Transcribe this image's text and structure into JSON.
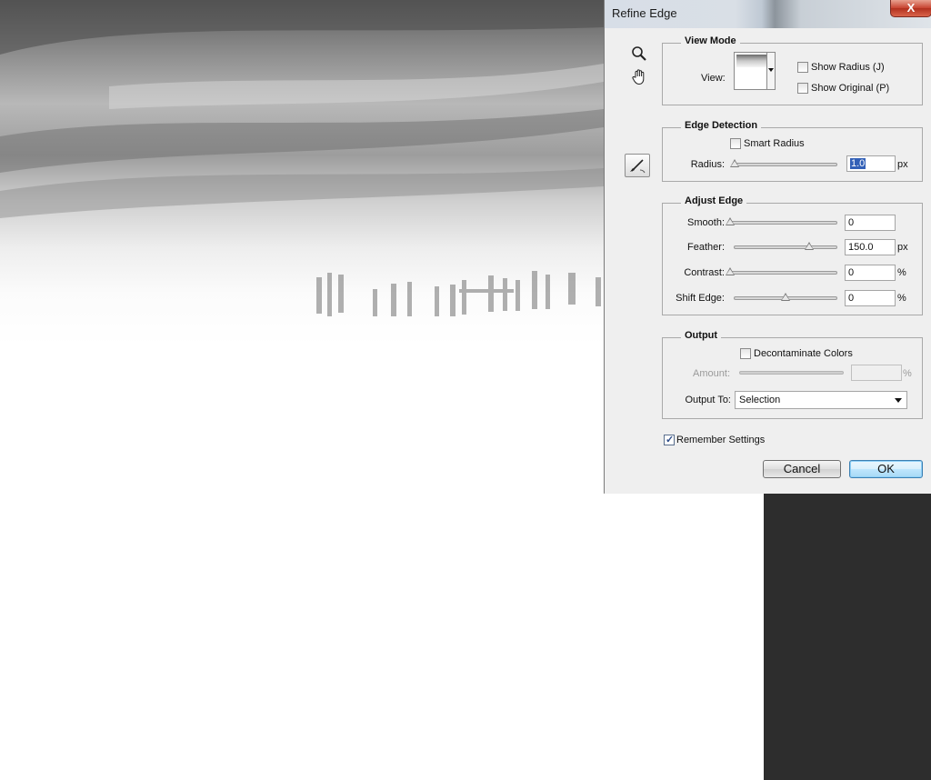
{
  "dialog": {
    "title": "Refine Edge",
    "close_label": "X"
  },
  "view_mode": {
    "legend": "View Mode",
    "view_label": "View:",
    "show_radius": {
      "label": "Show Radius (J)",
      "checked": false
    },
    "show_original": {
      "label": "Show Original (P)",
      "checked": false
    }
  },
  "edge_detection": {
    "legend": "Edge Detection",
    "smart_radius": {
      "label": "Smart Radius",
      "checked": false
    },
    "radius": {
      "label": "Radius:",
      "value": "1.0",
      "unit": "px",
      "slider_fraction": 0.0
    }
  },
  "adjust_edge": {
    "legend": "Adjust Edge",
    "smooth": {
      "label": "Smooth:",
      "value": "0",
      "unit": "",
      "slider_fraction": 0.0
    },
    "feather": {
      "label": "Feather:",
      "value": "150.0",
      "unit": "px",
      "slider_fraction": 0.73
    },
    "contrast": {
      "label": "Contrast:",
      "value": "0",
      "unit": "%",
      "slider_fraction": 0.0
    },
    "shift_edge": {
      "label": "Shift Edge:",
      "value": "0",
      "unit": "%",
      "slider_fraction": 0.5
    }
  },
  "output": {
    "legend": "Output",
    "decontaminate": {
      "label": "Decontaminate Colors",
      "checked": false
    },
    "amount": {
      "label": "Amount:",
      "value": "",
      "unit": "%"
    },
    "output_to_label": "Output To:",
    "output_to_value": "Selection"
  },
  "remember_settings": {
    "label": "Remember Settings",
    "checked": true
  },
  "buttons": {
    "cancel": "Cancel",
    "ok": "OK"
  },
  "tools": [
    "zoom-icon",
    "hand-icon",
    "refine-radius-brush-icon"
  ]
}
